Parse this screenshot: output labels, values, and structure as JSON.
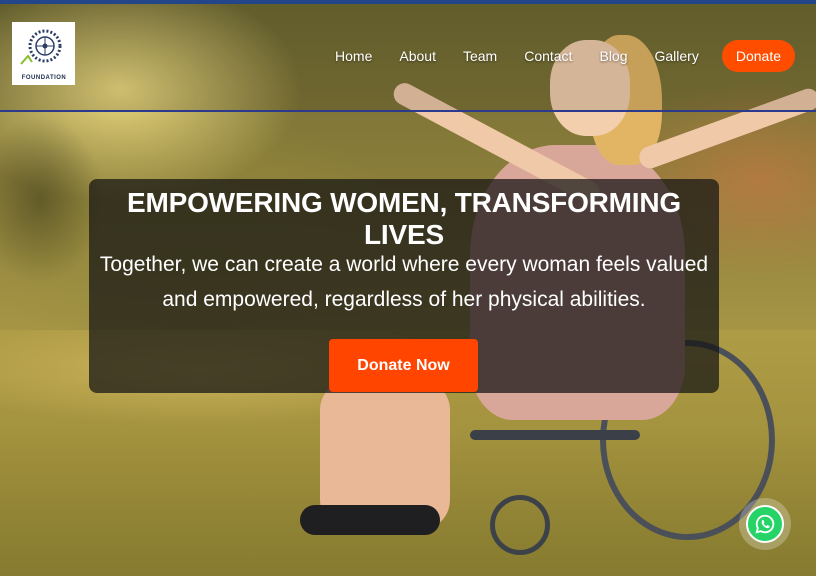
{
  "logo": {
    "alt_name": "The Wheels Foundation",
    "text": "FOUNDATION",
    "icon": "wheel-logo-icon"
  },
  "nav": {
    "items": [
      {
        "label": "Home"
      },
      {
        "label": "About"
      },
      {
        "label": "Team"
      },
      {
        "label": "Contact"
      },
      {
        "label": "Blog"
      },
      {
        "label": "Gallery"
      }
    ],
    "donate_label": "Donate"
  },
  "hero": {
    "title": "EMPOWERING WOMEN, TRANSFORMING LIVES",
    "subtitle_line1": "Together, we can create a world where every woman feels valued",
    "subtitle_line2": "and empowered, regardless of her physical abilities.",
    "cta_label": "Donate Now"
  },
  "floating": {
    "icon": "whatsapp-icon"
  },
  "colors": {
    "accent": "#ff4500",
    "top_bar": "#23458a",
    "whatsapp": "#25d366"
  }
}
